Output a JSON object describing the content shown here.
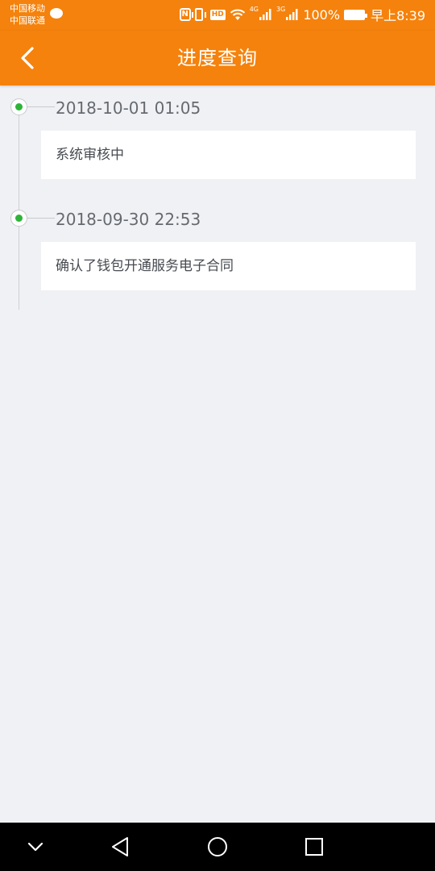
{
  "status_bar": {
    "carrier_1": "中国移动",
    "carrier_2": "中国联通",
    "network_1": "4G",
    "network_2": "3G",
    "battery": "100%",
    "time": "早上8:39"
  },
  "header": {
    "title": "进度查询"
  },
  "timeline": [
    {
      "time": "2018-10-01 01:05",
      "status": "系统审核中"
    },
    {
      "time": "2018-09-30 22:53",
      "status": "确认了钱包开通服务电子合同"
    }
  ],
  "colors": {
    "accent": "#f5820c",
    "background": "#f0f1f4",
    "dot": "#2fb43a"
  }
}
